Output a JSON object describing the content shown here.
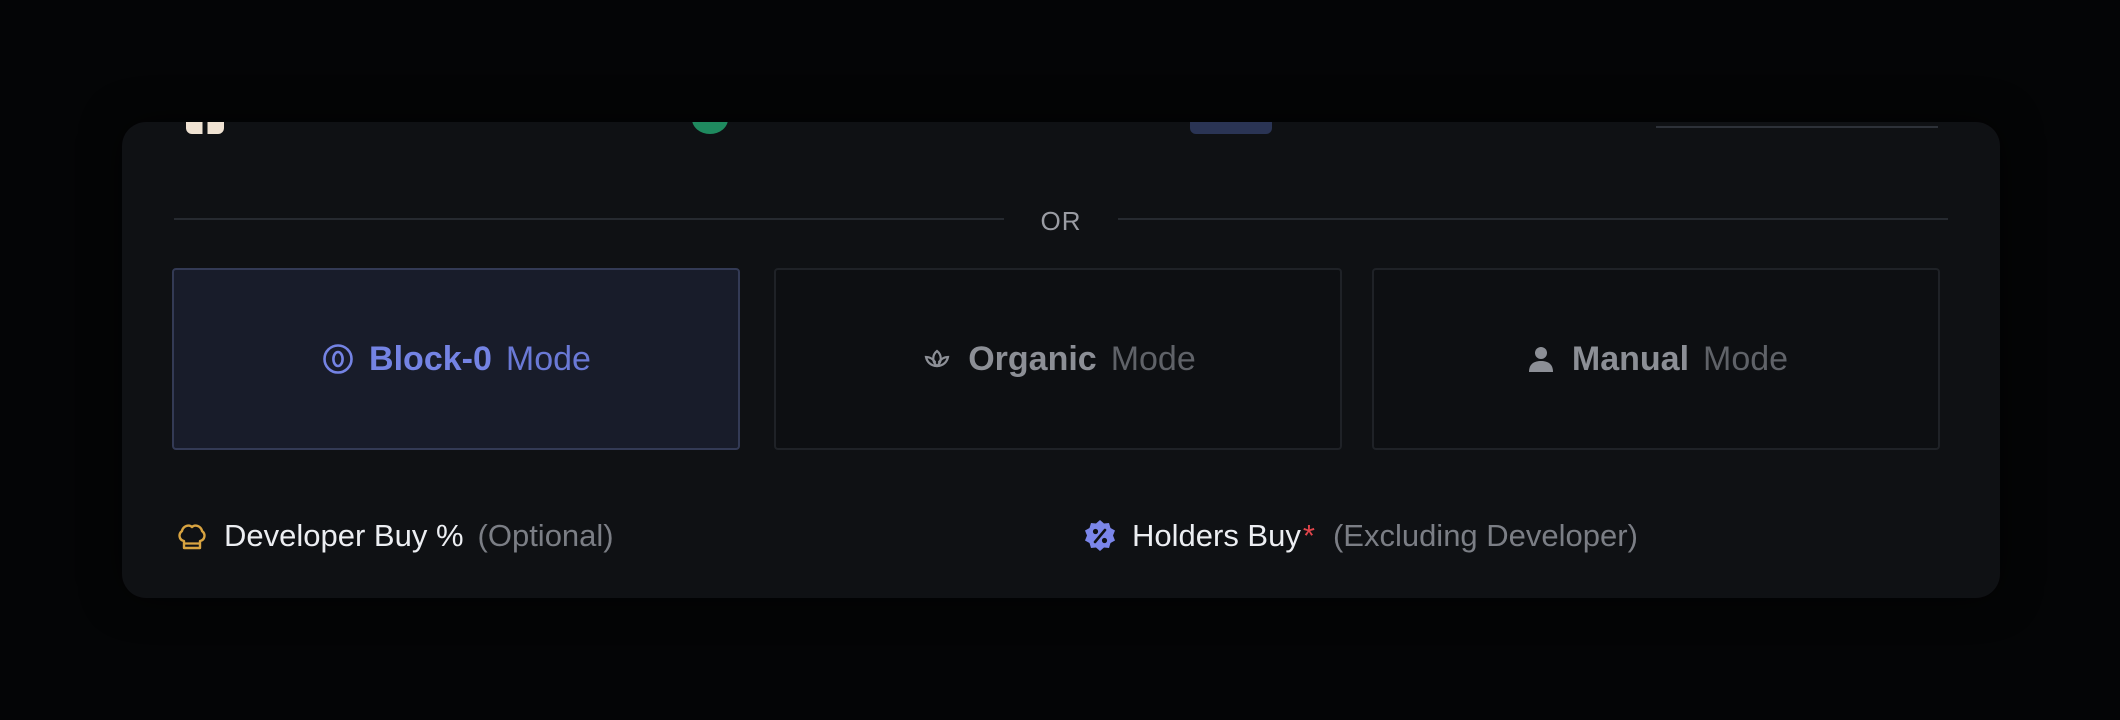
{
  "divider": {
    "label": "OR"
  },
  "peek_items": [
    "",
    "",
    "",
    ""
  ],
  "modes": [
    {
      "name": "Block-0",
      "suffix": "Mode",
      "icon": "block-zero-icon",
      "selected": true
    },
    {
      "name": "Organic",
      "suffix": "Mode",
      "icon": "lotus-icon",
      "selected": false
    },
    {
      "name": "Manual",
      "suffix": "Mode",
      "icon": "person-icon",
      "selected": false
    }
  ],
  "developer_buy": {
    "label": "Developer Buy %",
    "hint": "(Optional)",
    "icon": "chef-hat-icon"
  },
  "holders_buy": {
    "label": "Holders Buy",
    "required_mark": "*",
    "hint": "(Excluding Developer)",
    "icon": "percent-badge-icon"
  },
  "colors": {
    "accent": "#7483e4",
    "selected_bg": "#181c2a",
    "panel_bg": "#0f1114",
    "required": "#e0454b",
    "developer_icon": "#d9a441"
  }
}
